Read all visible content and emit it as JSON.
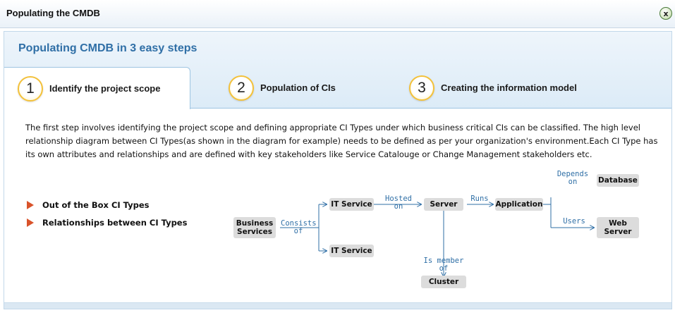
{
  "window": {
    "title": "Populating the CMDB",
    "close_label": "x"
  },
  "panel": {
    "title": "Populating CMDB in 3 easy steps"
  },
  "tabs": [
    {
      "num": "1",
      "label": "Identify the project scope",
      "active": true
    },
    {
      "num": "2",
      "label": "Population of CIs",
      "active": false
    },
    {
      "num": "3",
      "label": "Creating the information model",
      "active": false
    }
  ],
  "description": "The first step involves identifying the project scope and defining appropriate CI Types under which business critical CIs can be classified. The high level relationship diagram between CI Types(as shown in the diagram for example) needs to be defined as per your organization's environment.Each CI Type has its own attributes and relationships and are defined with key stakeholders like Service Catalouge or Change Management stakeholders etc.",
  "links": [
    "Out of the Box CI Types",
    "Relationships between CI Types"
  ],
  "diagram": {
    "nodes": {
      "business_services": "Business Services",
      "it_service_1": "IT Service",
      "it_service_2": "IT Service",
      "server": "Server",
      "application": "Application",
      "cluster": "Cluster",
      "database": "Database",
      "web_server": "Web Server"
    },
    "edges": {
      "consists_of": "Consists of",
      "hosted_on": "Hosted on",
      "runs": "Runs",
      "is_member_of": "Is member of",
      "depends_on": "Depends on",
      "users": "Users"
    }
  },
  "colors": {
    "accent": "#2f6fa6",
    "tab_ring": "#f3c13a",
    "bullet": "#d9532b",
    "node_bg": "#dcdcdc"
  }
}
